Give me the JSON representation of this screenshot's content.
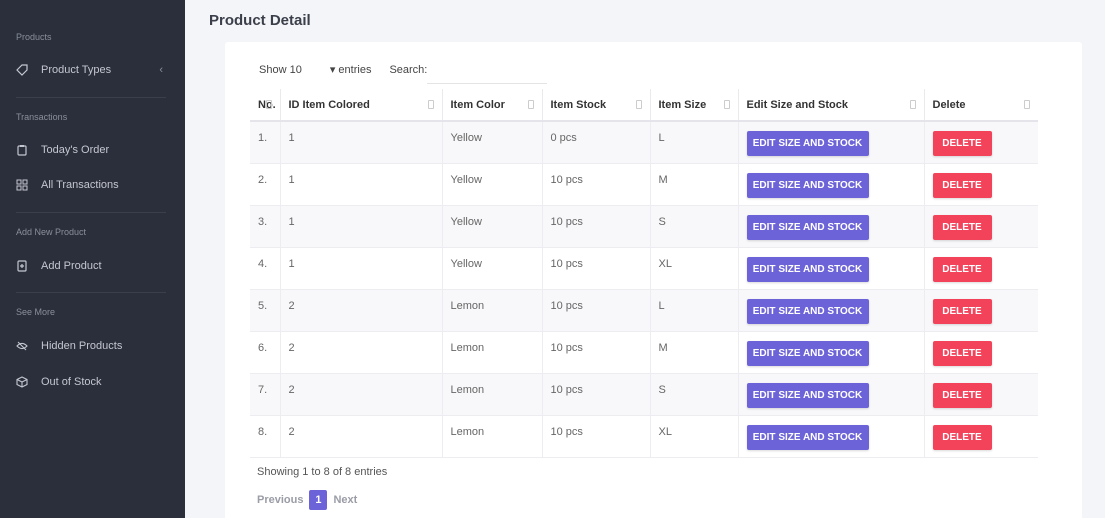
{
  "sidebar": {
    "sections": [
      {
        "title": "Products",
        "items": [
          {
            "label": "Product Types",
            "icon": "tag-icon",
            "chevron": "‹"
          }
        ]
      },
      {
        "title": "Transactions",
        "items": [
          {
            "label": "Today's Order",
            "icon": "clipboard-icon"
          },
          {
            "label": "All Transactions",
            "icon": "grid-icon"
          }
        ]
      },
      {
        "title": "Add New Product",
        "items": [
          {
            "label": "Add Product",
            "icon": "file-plus-icon"
          }
        ]
      },
      {
        "title": "See More",
        "items": [
          {
            "label": "Hidden Products",
            "icon": "eye-off-icon"
          },
          {
            "label": "Out of Stock",
            "icon": "box-icon"
          }
        ]
      }
    ]
  },
  "page": {
    "title": "Product Detail"
  },
  "controls": {
    "show_label": "Show",
    "show_value": "10",
    "entries_label": "▾ entries",
    "search_label": "Search:",
    "search_value": ""
  },
  "table": {
    "headers": [
      "No.",
      "ID Item Colored",
      "Item Color",
      "Item Stock",
      "Item Size",
      "Edit Size and Stock",
      "Delete"
    ],
    "edit_button_label": "EDIT SIZE AND STOCK",
    "delete_button_label": "DELETE",
    "rows": [
      {
        "no": "1.",
        "id": "1",
        "color": "Yellow",
        "stock": "0 pcs",
        "size": "L"
      },
      {
        "no": "2.",
        "id": "1",
        "color": "Yellow",
        "stock": "10 pcs",
        "size": "M"
      },
      {
        "no": "3.",
        "id": "1",
        "color": "Yellow",
        "stock": "10 pcs",
        "size": "S"
      },
      {
        "no": "4.",
        "id": "1",
        "color": "Yellow",
        "stock": "10 pcs",
        "size": "XL"
      },
      {
        "no": "5.",
        "id": "2",
        "color": "Lemon",
        "stock": "10 pcs",
        "size": "L"
      },
      {
        "no": "6.",
        "id": "2",
        "color": "Lemon",
        "stock": "10 pcs",
        "size": "M"
      },
      {
        "no": "7.",
        "id": "2",
        "color": "Lemon",
        "stock": "10 pcs",
        "size": "S"
      },
      {
        "no": "8.",
        "id": "2",
        "color": "Lemon",
        "stock": "10 pcs",
        "size": "XL"
      }
    ]
  },
  "footer": {
    "info": "Showing 1 to 8 of 8 entries",
    "previous": "Previous",
    "page": "1",
    "next": "Next"
  },
  "colors": {
    "sidebar_bg": "#2b2f3b",
    "edit_button": "#6c63d9",
    "delete_button": "#f2435a",
    "page_bg": "#f4f5f8"
  }
}
